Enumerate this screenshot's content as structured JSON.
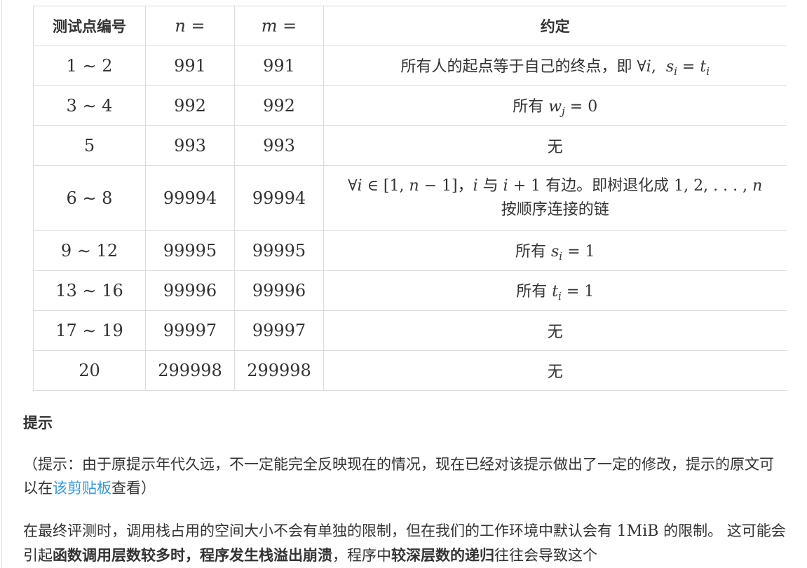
{
  "table": {
    "headers": {
      "col_id": "测试点编号",
      "col_n": "n =",
      "col_m": "m =",
      "col_rule": "约定"
    },
    "rows": [
      {
        "id": "1 ∼ 2",
        "n": "991",
        "m": "991",
        "rule_text": "所有人的起点等于自己的终点，即 ",
        "rule_math": "∀i, sᵢ = tᵢ"
      },
      {
        "id": "3 ∼ 4",
        "n": "992",
        "m": "992",
        "rule_text": "所有 ",
        "rule_math": "wⱼ = 0"
      },
      {
        "id": "5",
        "n": "993",
        "m": "993",
        "rule_text": "无"
      },
      {
        "id": "6 ∼ 8",
        "n": "99994",
        "m": "99994",
        "rule_line1_math": "∀i ∈ [1, n − 1]，i 与 i + 1",
        "rule_line1_text": " 有边。即树退化成 ",
        "rule_line1_math2": "1, 2, . . . , n",
        "rule_line2": "按顺序连接的链"
      },
      {
        "id": "9 ∼ 12",
        "n": "99995",
        "m": "99995",
        "rule_text": "所有 ",
        "rule_math": "sᵢ = 1"
      },
      {
        "id": "13 ∼ 16",
        "n": "99996",
        "m": "99996",
        "rule_text": "所有 ",
        "rule_math": "tᵢ = 1"
      },
      {
        "id": "17 ∼ 19",
        "n": "99997",
        "m": "99997",
        "rule_text": "无"
      },
      {
        "id": "20",
        "n": "299998",
        "m": "299998",
        "rule_text": "无"
      }
    ]
  },
  "hint": {
    "title": "提示",
    "para1_before": "（提示：由于原提示年代久远，不一定能完全反映现在的情况，现在已经对该提示做出了一定的修改，提示的原文可以在",
    "para1_link": "该剪贴板",
    "para1_after": "查看）",
    "para2_a": "在最终评测时，调用栈占用的空间大小不会有单独的限制，但在我们的工作环境中默认会有 ",
    "para2_mib": "1MiB",
    "para2_b": " 的限制。 这可能会引起",
    "para2_bold1": "函数调用层数较多时，程序发生栈溢出崩溃",
    "para2_c": "，程序中",
    "para2_bold2": "较深层数的递归",
    "para2_d": "往往会导致这个"
  }
}
